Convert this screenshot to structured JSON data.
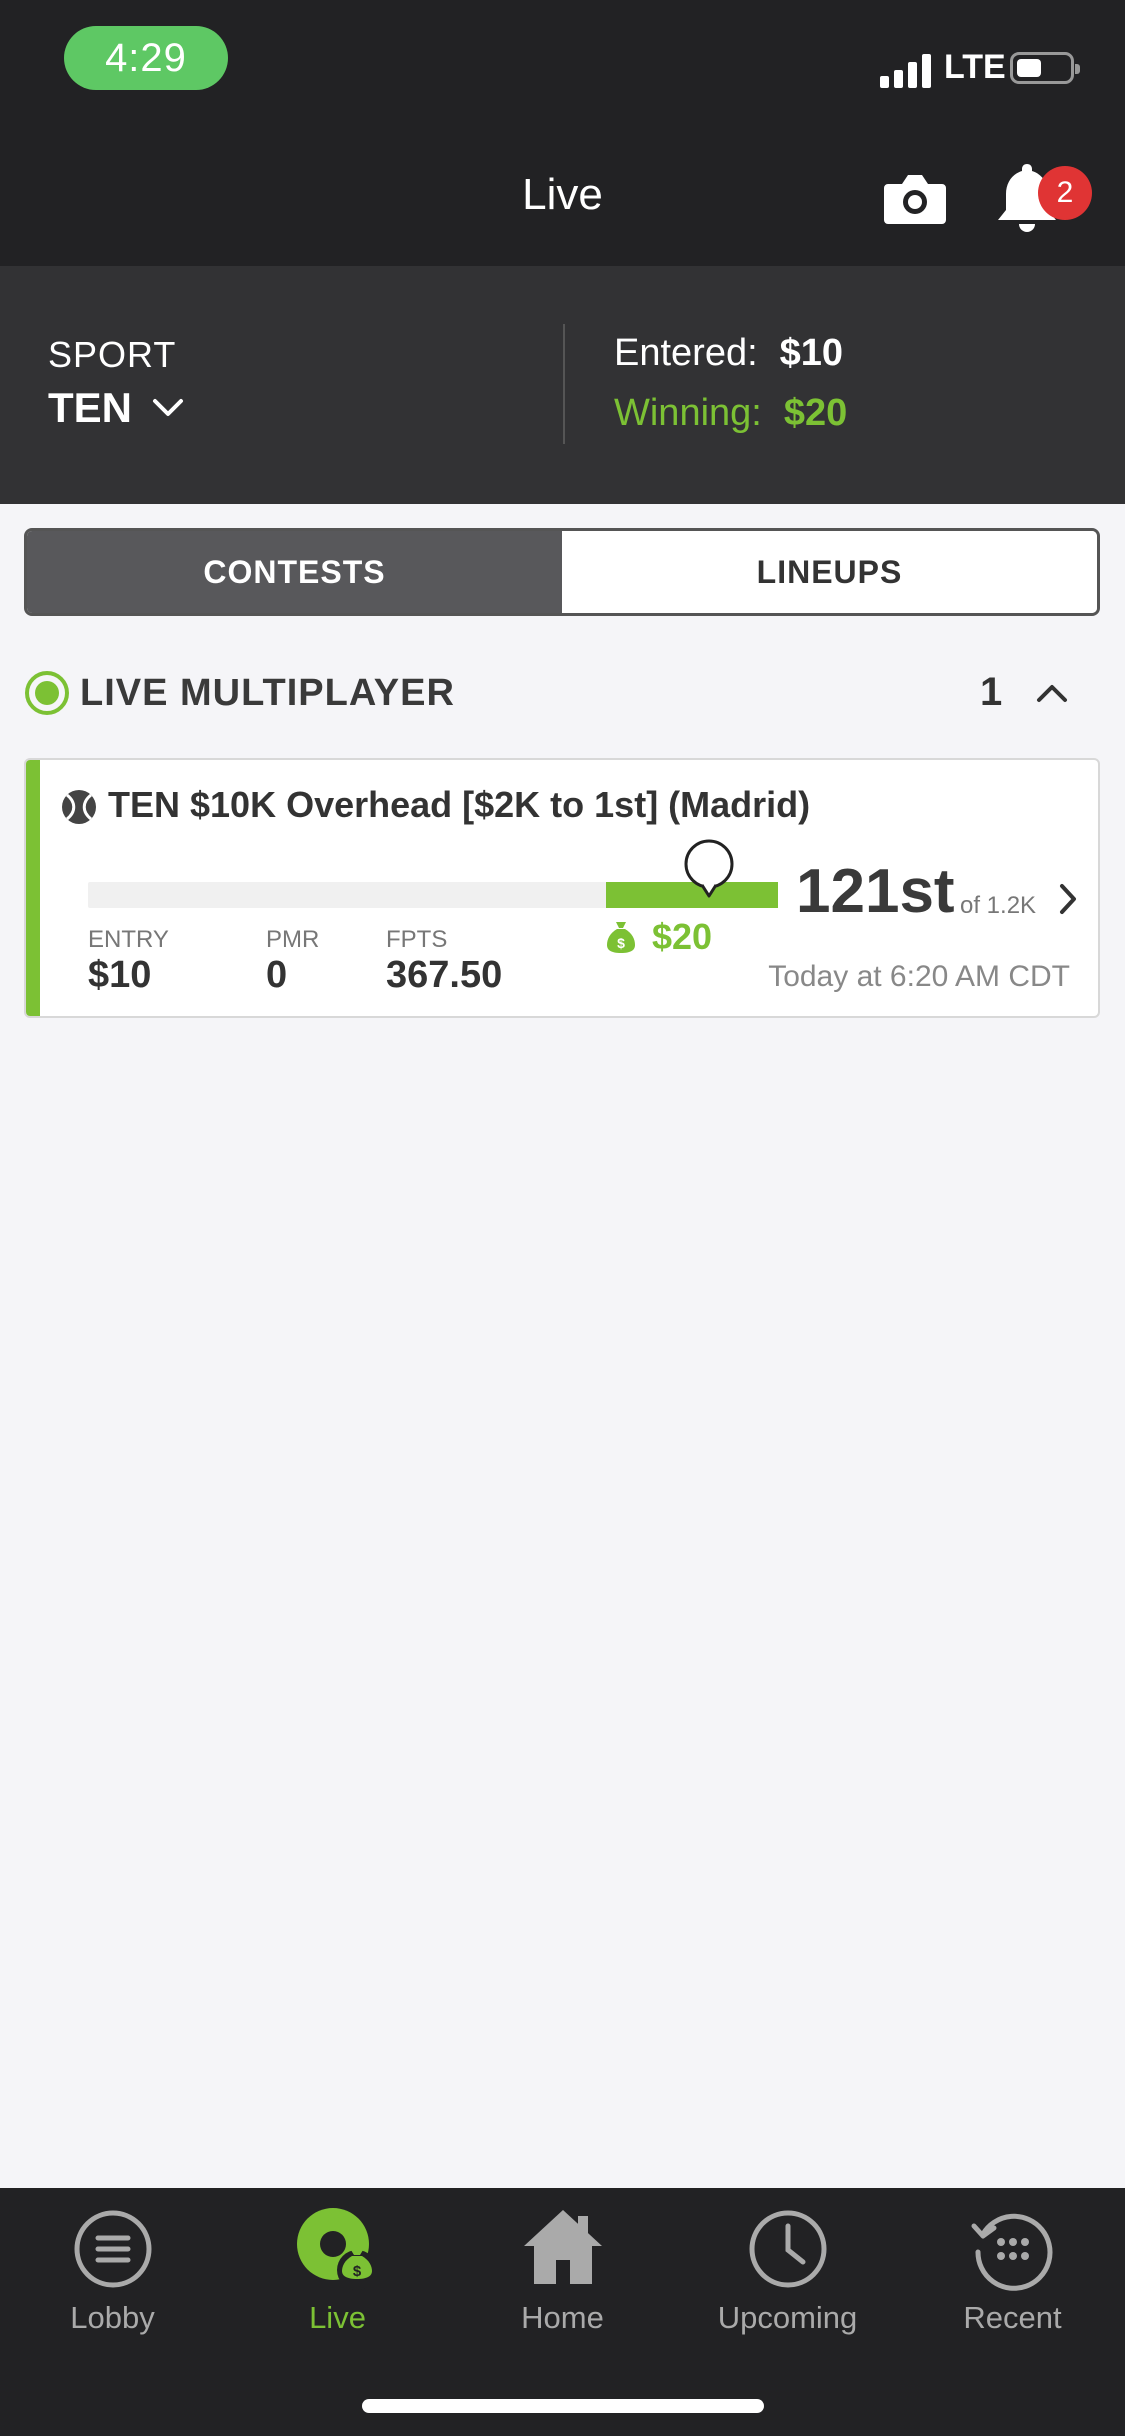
{
  "status_bar": {
    "time": "4:29",
    "network": "LTE"
  },
  "nav": {
    "title": "Live",
    "notifications_count": "2"
  },
  "summary": {
    "sport_label": "SPORT",
    "sport_value": "TEN",
    "entered_label": "Entered:",
    "entered_value": "$10",
    "winning_label": "Winning:",
    "winning_value": "$20"
  },
  "segments": [
    {
      "label": "CONTESTS",
      "active": true
    },
    {
      "label": "LINEUPS",
      "active": false
    }
  ],
  "section": {
    "title": "LIVE MULTIPLAYER",
    "count": "1"
  },
  "contest": {
    "title": "TEN $10K Overhead [$2K to 1st] (Madrid)",
    "entry_label": "ENTRY",
    "entry_value": "$10",
    "pmr_label": "PMR",
    "pmr_value": "0",
    "fpts_label": "FPTS",
    "fpts_value": "367.50",
    "prize": "$20",
    "rank": "121st",
    "rank_of": "of 1.2K",
    "time": "Today at 6:20 AM CDT",
    "paid_zone_fraction": 0.25,
    "position_fraction": 0.9,
    "accent_color": "#7cc134"
  },
  "tabs": [
    {
      "label": "Lobby",
      "icon": "lobby-icon",
      "active": false
    },
    {
      "label": "Live",
      "icon": "live-icon",
      "active": true
    },
    {
      "label": "Home",
      "icon": "home-icon",
      "active": false
    },
    {
      "label": "Upcoming",
      "icon": "clock-icon",
      "active": false
    },
    {
      "label": "Recent",
      "icon": "recent-icon",
      "active": false
    }
  ],
  "colors": {
    "accent": "#7cc134",
    "header_bg": "#222224",
    "badge": "#e03434"
  }
}
